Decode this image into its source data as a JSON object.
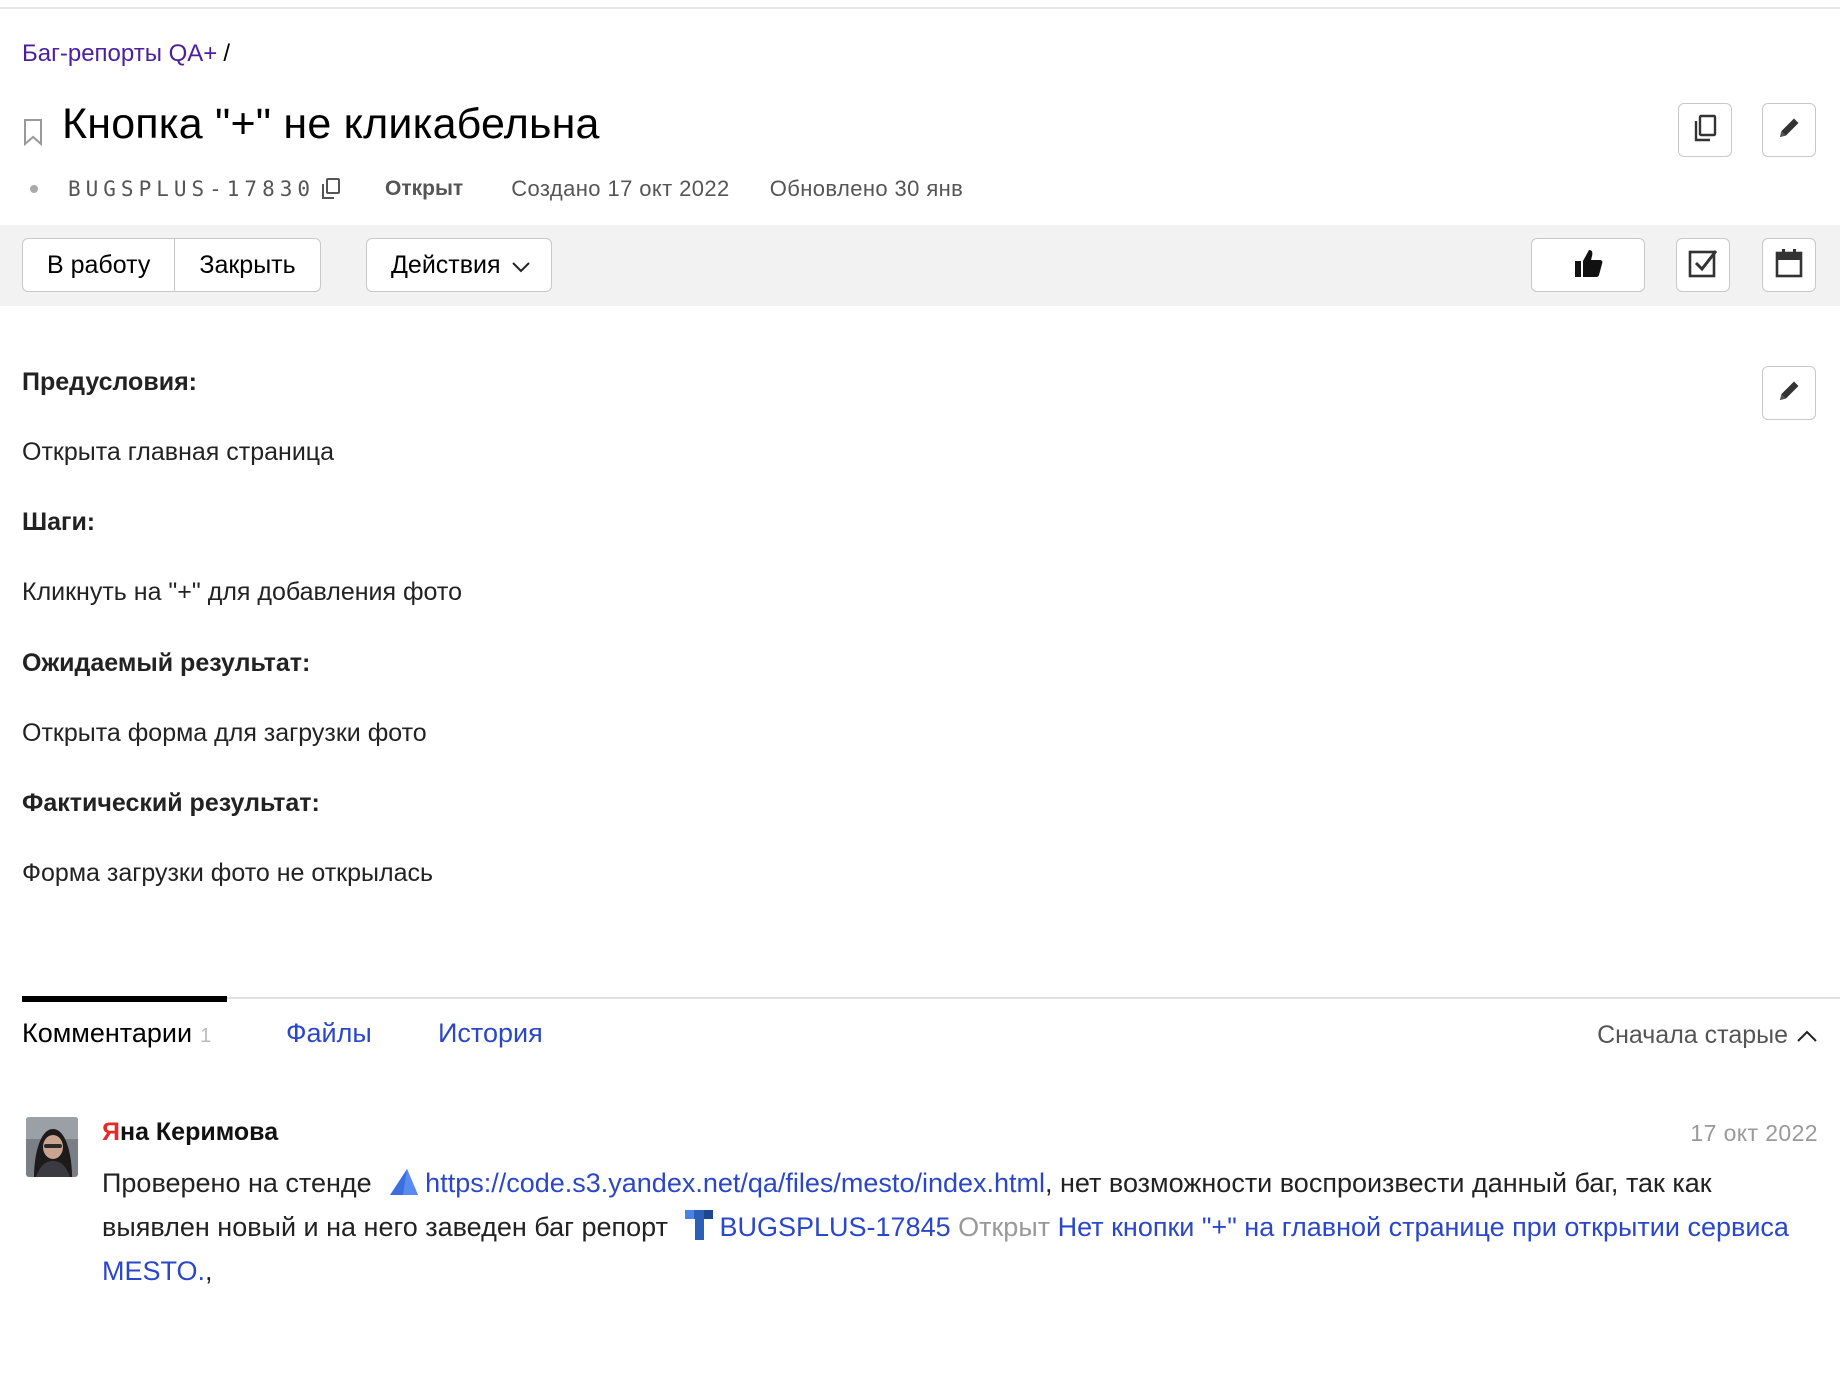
{
  "breadcrumb": {
    "queue": "Баг-репорты QA+",
    "separator": "/"
  },
  "issue": {
    "title": "Кнопка \"+\" не кликабельна",
    "key": "BUGSPLUS-17830",
    "status": "Открыт",
    "created": "Создано 17 окт 2022",
    "updated": "Обновлено 30 янв"
  },
  "toolbar": {
    "in_work": "В работу",
    "close": "Закрыть",
    "actions": "Действия",
    "icons": [
      "thumbs-up-icon",
      "checkbox-icon",
      "calendar-icon"
    ]
  },
  "header_icons": [
    "copy-icon",
    "pencil-icon"
  ],
  "description": {
    "pre_label": "Предусловия:",
    "pre_text": "Открыта главная страница",
    "steps_label": "Шаги:",
    "steps_text": "Кликнуть на \"+\" для добавления фото",
    "expected_label": "Ожидаемый результат:",
    "expected_text": "Открыта форма для загрузки фото",
    "actual_label": "Фактический результат:",
    "actual_text": "Форма загрузки фото не открылась"
  },
  "tabs": {
    "comments": "Комментарии",
    "comments_count": "1",
    "files": "Файлы",
    "history": "История",
    "sort": "Сначала старые"
  },
  "comment": {
    "author_first": "Я",
    "author_rest": "на Керимова",
    "date": "17 окт 2022",
    "text_1": "Проверено на стенде",
    "link_url": "https://code.s3.yandex.net/qa/files/mesto/index.html",
    "text_2": ", нет возможности воспроизвести данный баг, так как выявлен новый и на него заведен баг репорт",
    "linked_key": "BUGSPLUS-17845",
    "linked_status": "Открыт",
    "linked_title": "Нет кнопки \"+\" на главной странице при открытии сервиса MESTO.",
    "trailing": ","
  },
  "colors": {
    "link": "#2b47c9",
    "breadcrumb": "#4b1fa0",
    "toolbar_bg": "#f2f2f2",
    "author_accent": "#e52a2a"
  }
}
